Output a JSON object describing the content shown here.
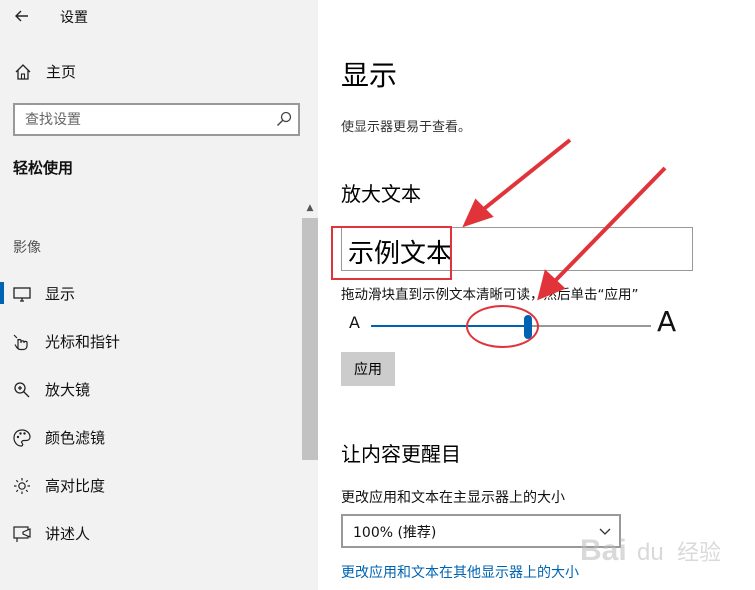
{
  "window": {
    "title": "设置",
    "back_icon": "back-arrow-icon"
  },
  "sidebar": {
    "home_label": "主页",
    "search_placeholder": "查找设置",
    "category": "轻松使用",
    "section_label": "影像",
    "items": [
      {
        "label": "显示",
        "icon": "monitor-icon",
        "selected": true
      },
      {
        "label": "光标和指针",
        "icon": "pointer-hand-icon",
        "selected": false
      },
      {
        "label": "放大镜",
        "icon": "magnifier-icon",
        "selected": false
      },
      {
        "label": "颜色滤镜",
        "icon": "palette-icon",
        "selected": false
      },
      {
        "label": "高对比度",
        "icon": "sun-icon",
        "selected": false
      },
      {
        "label": "讲述人",
        "icon": "narrator-icon",
        "selected": false
      }
    ]
  },
  "main": {
    "title": "显示",
    "subtitle": "使显示器更易于查看。",
    "enlarge_heading": "放大文本",
    "sample_text": "示例文本",
    "slider_instruction": "拖动滑块直到示例文本清晰可读，然后单击“应用”",
    "slider_small_label": "A",
    "slider_large_label": "A",
    "slider_value_fraction": 0.56,
    "apply_label": "应用",
    "content_heading": "让内容更醒目",
    "scale_label": "更改应用和文本在主显示器上的大小",
    "scale_value": "100% (推荐)",
    "other_display_link": "更改应用和文本在其他显示器上的大小"
  },
  "colors": {
    "accent": "#0063b1",
    "annotation": "#e0343a",
    "sidebar_bg": "#f2f2f2"
  },
  "watermark": {
    "text": "Baidu 经验"
  }
}
